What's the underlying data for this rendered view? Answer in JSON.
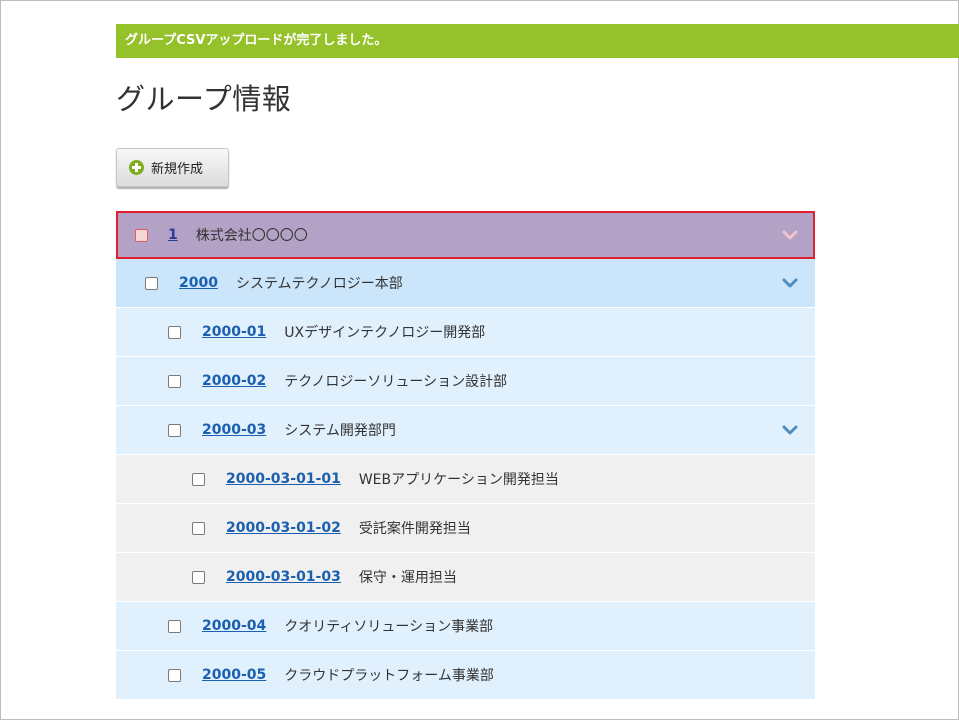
{
  "notice": "グループCSVアップロードが完了しました。",
  "page_title": "グループ情報",
  "new_button_label": "新規作成",
  "colors": {
    "notice_bg": "#95c12b",
    "selected_row_bg": "#b3a2c6",
    "selected_row_border": "#e0202e",
    "link": "#1a5fb0"
  },
  "groups": [
    {
      "code": "1",
      "name": "株式会社〇〇〇〇",
      "level": 0,
      "expanded": true,
      "checked": false,
      "selected": true
    },
    {
      "code": "2000",
      "name": "システムテクノロジー本部",
      "level": 1,
      "expanded": true,
      "checked": false
    },
    {
      "code": "2000-01",
      "name": "UXデザインテクノロジー開発部",
      "level": 2,
      "checked": false
    },
    {
      "code": "2000-02",
      "name": "テクノロジーソリューション設計部",
      "level": 2,
      "checked": false
    },
    {
      "code": "2000-03",
      "name": "システム開発部門",
      "level": 2,
      "expanded": true,
      "checked": false
    },
    {
      "code": "2000-03-01-01",
      "name": "WEBアプリケーション開発担当",
      "level": 3,
      "checked": false
    },
    {
      "code": "2000-03-01-02",
      "name": "受託案件開発担当",
      "level": 3,
      "checked": false
    },
    {
      "code": "2000-03-01-03",
      "name": "保守・運用担当",
      "level": 3,
      "checked": false
    },
    {
      "code": "2000-04",
      "name": "クオリティソリューション事業部",
      "level": 2,
      "checked": false
    },
    {
      "code": "2000-05",
      "name": "クラウドプラットフォーム事業部",
      "level": 2,
      "checked": false
    }
  ]
}
